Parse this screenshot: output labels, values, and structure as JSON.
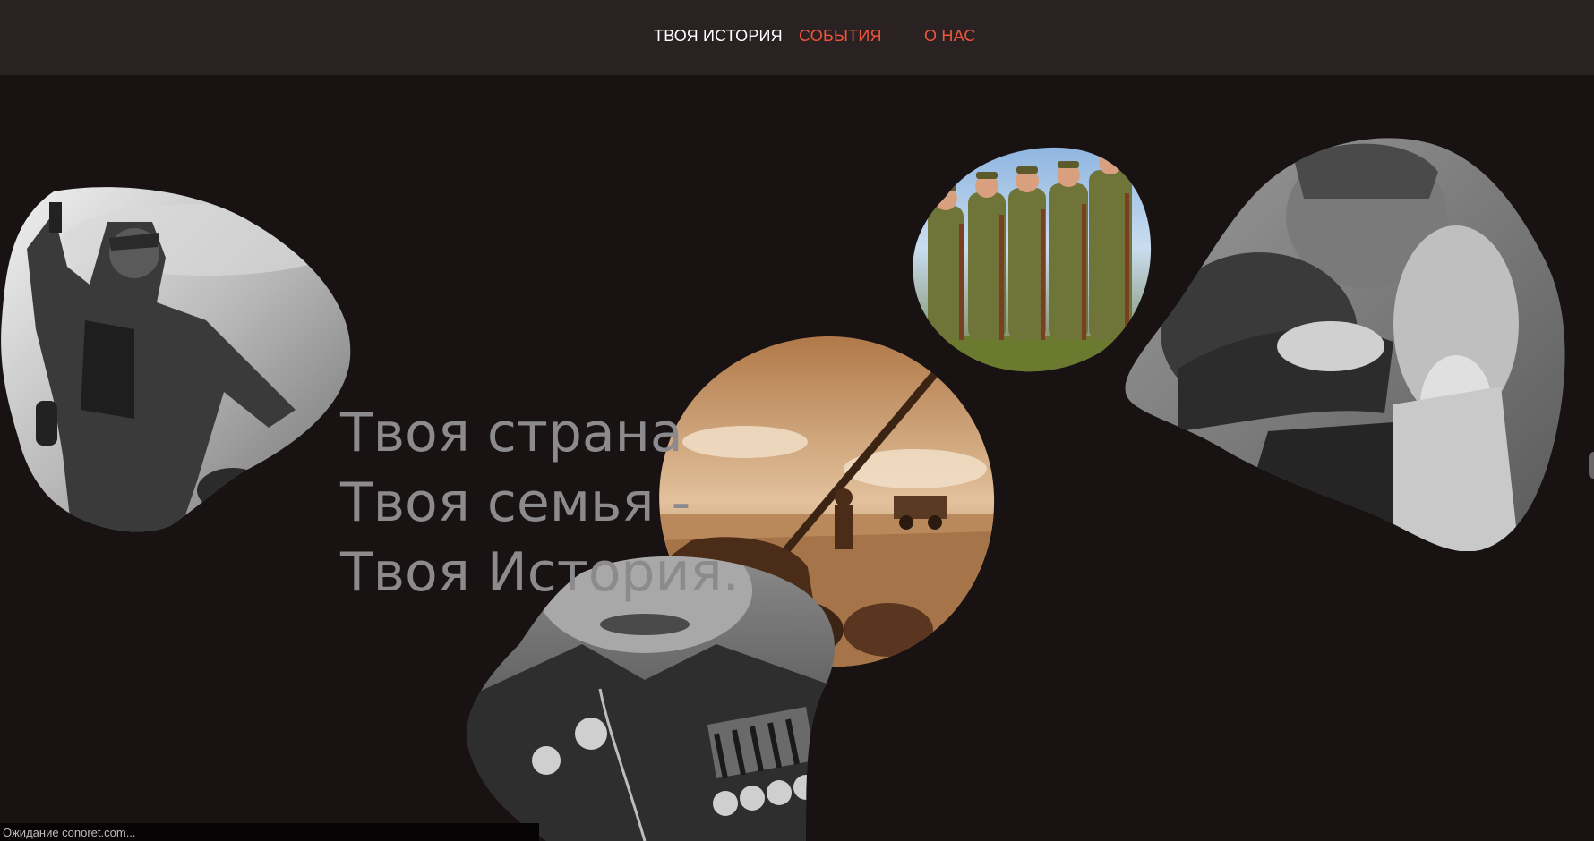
{
  "nav": {
    "items": [
      {
        "label": "ТВОЯ ИСТОРИЯ",
        "color": "#ffffff"
      },
      {
        "label": "СОБЫТИЯ",
        "color": "#f0553c"
      },
      {
        "label": "О НАС",
        "color": "#f0553c"
      }
    ]
  },
  "hero": {
    "lines": [
      "Твоя страна",
      "Твоя семья -",
      "Твоя История."
    ]
  },
  "photos": [
    {
      "name": "soldier-charge-photo",
      "icon": "photo-icon"
    },
    {
      "name": "women-soldiers-photo",
      "icon": "photo-icon"
    },
    {
      "name": "embrace-reunion-photo",
      "icon": "photo-icon"
    },
    {
      "name": "anti-aircraft-gun-photo",
      "icon": "photo-icon"
    },
    {
      "name": "veteran-medals-photo",
      "icon": "photo-icon"
    }
  ],
  "status_bar": {
    "text": "Ожидание conoret.com..."
  },
  "colors": {
    "background": "#181213",
    "header": "#292122",
    "accent": "#f0553c",
    "headline": "#8c8a8c"
  }
}
